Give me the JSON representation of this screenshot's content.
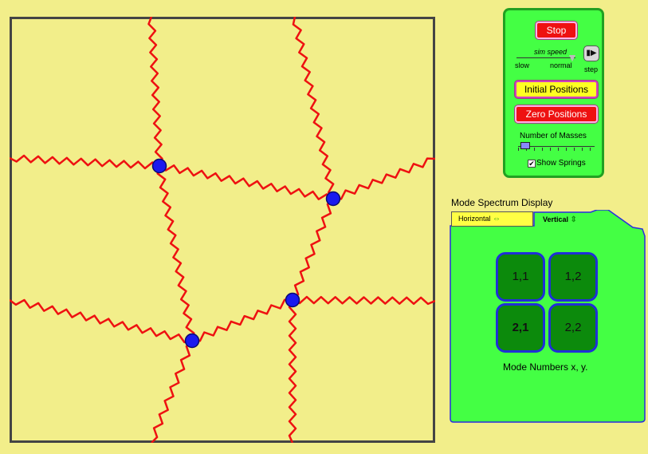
{
  "controls": {
    "stop_label": "Stop",
    "speed_label": "sim speed",
    "speed_slow_label": "slow",
    "speed_normal_label": "normal",
    "speed_value": "normal",
    "step_label": "step",
    "initial_positions_label": "Initial Positions",
    "zero_positions_label": "Zero Positions",
    "num_masses_label": "Number of Masses",
    "num_masses_value": 2,
    "show_springs_label": "Show Springs",
    "show_springs_checked": true
  },
  "mode_display": {
    "title": "Mode Spectrum Display",
    "tabs": [
      {
        "label": "Horizontal",
        "icon": "horizontal-arrows-icon",
        "active": false
      },
      {
        "label": "Vertical",
        "icon": "vertical-arrows-icon",
        "active": true
      }
    ],
    "modes": [
      {
        "label": "1,1",
        "selected": false
      },
      {
        "label": "1,2",
        "selected": false
      },
      {
        "label": "2,1",
        "selected": true
      },
      {
        "label": "2,2",
        "selected": false
      }
    ],
    "caption": "Mode Numbers x, y."
  },
  "colors": {
    "background": "#f2ee8a",
    "spring": "#ee1111",
    "mass": "#1a1aee",
    "panel": "#44ff44",
    "mode_button": "#0c8a0c"
  }
}
